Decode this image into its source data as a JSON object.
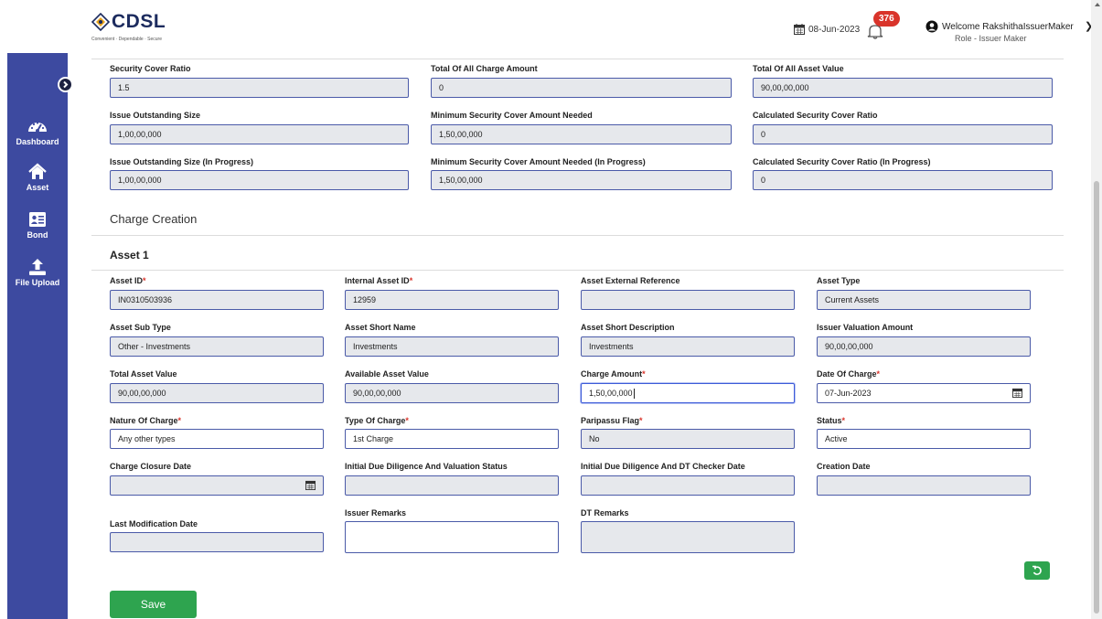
{
  "header": {
    "logo_text": "CDSL",
    "logo_tagline": "Convenient · Dependable · Secure",
    "date": "08-Jun-2023",
    "notification_count": "376",
    "welcome": "Welcome RakshithaIssuerMaker",
    "role": "Role - Issuer Maker"
  },
  "sidebar": {
    "items": [
      {
        "label": "Dashboard",
        "icon": "dashboard-gauge-icon"
      },
      {
        "label": "Asset",
        "icon": "home-icon"
      },
      {
        "label": "Bond",
        "icon": "id-card-icon"
      },
      {
        "label": "File Upload",
        "icon": "upload-icon"
      }
    ]
  },
  "summary": [
    {
      "label": "Security Cover Ratio",
      "value": "1.5"
    },
    {
      "label": "Total Of All Charge Amount",
      "value": "0"
    },
    {
      "label": "Total Of All Asset Value",
      "value": "90,00,00,000"
    },
    {
      "label": "Issue Outstanding Size",
      "value": "1,00,00,000"
    },
    {
      "label": "Minimum Security Cover Amount Needed",
      "value": "1,50,00,000"
    },
    {
      "label": "Calculated Security Cover Ratio",
      "value": "0"
    },
    {
      "label": "Issue Outstanding Size (In Progress)",
      "value": "1,00,00,000"
    },
    {
      "label": "Minimum Security Cover Amount Needed (In Progress)",
      "value": "1,50,00,000"
    },
    {
      "label": "Calculated Security Cover Ratio (In Progress)",
      "value": "0"
    }
  ],
  "charge_creation_title": "Charge Creation",
  "asset_title": "Asset 1",
  "asset_fields": [
    {
      "label": "Asset ID",
      "value": "IN0310503936",
      "required": true
    },
    {
      "label": "Internal Asset ID",
      "value": "12959",
      "required": true
    },
    {
      "label": "Asset External Reference",
      "value": "",
      "required": false
    },
    {
      "label": "Asset Type",
      "value": "Current Assets",
      "required": false
    },
    {
      "label": "Asset Sub Type",
      "value": "Other - Investments",
      "required": false
    },
    {
      "label": "Asset Short Name",
      "value": "Investments",
      "required": false
    },
    {
      "label": "Asset Short Description",
      "value": "Investments",
      "required": false
    },
    {
      "label": "Issuer Valuation Amount",
      "value": "90,00,00,000",
      "required": false
    },
    {
      "label": "Total Asset Value",
      "value": "90,00,00,000",
      "required": false
    },
    {
      "label": "Available Asset Value",
      "value": "90,00,00,000",
      "required": false
    },
    {
      "label": "Charge Amount",
      "value": "1,50,00,000",
      "required": true
    },
    {
      "label": "Date Of Charge",
      "value": "07-Jun-2023",
      "required": true
    },
    {
      "label": "Nature Of Charge",
      "value": "Any other types",
      "required": true
    },
    {
      "label": "Type Of Charge",
      "value": "1st Charge",
      "required": true
    },
    {
      "label": "Paripassu Flag",
      "value": "No",
      "required": true
    },
    {
      "label": "Status",
      "value": "Active",
      "required": true
    },
    {
      "label": "Charge Closure Date",
      "value": "",
      "required": false
    },
    {
      "label": "Initial Due Diligence And Valuation Status",
      "value": "",
      "required": false
    },
    {
      "label": "Initial Due Diligence And DT Checker Date",
      "value": "",
      "required": false
    },
    {
      "label": "Creation Date",
      "value": "",
      "required": false
    },
    {
      "label": "Last Modification Date",
      "value": "",
      "required": false
    },
    {
      "label": "Issuer Remarks",
      "value": "",
      "required": false
    },
    {
      "label": "DT Remarks",
      "value": "",
      "required": false
    }
  ],
  "required_marker": "*",
  "save_label": "Save",
  "colors": {
    "sidebar": "#3d4aa0",
    "field_border": "#4a5aa8",
    "field_readonly_bg": "#e6e8ec",
    "save_button": "#2ea44f",
    "badge": "#d9342b"
  }
}
